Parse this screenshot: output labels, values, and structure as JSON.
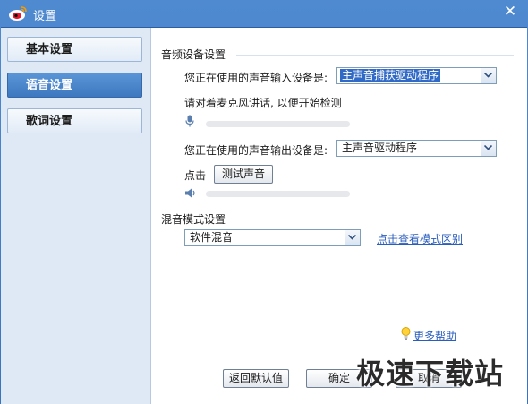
{
  "window": {
    "title": "设置",
    "close_glyph": "✕"
  },
  "sidebar": {
    "items": [
      {
        "label": "基本设置",
        "active": false
      },
      {
        "label": "语音设置",
        "active": true
      },
      {
        "label": "歌词设置",
        "active": false
      }
    ]
  },
  "audio_device": {
    "section_title": "音频设备设置",
    "input_label": "您正在使用的声音输入设备是:",
    "input_value": "主声音捕获驱动程序",
    "mic_hint": "请对着麦克风讲话, 以便开始检测",
    "mic_level": 0,
    "output_label": "您正在使用的声音输出设备是:",
    "output_value": "主声音驱动程序",
    "click_label": "点击",
    "test_button": "测试声音",
    "speaker_level": 0
  },
  "mix_mode": {
    "section_title": "混音模式设置",
    "mode_value": "软件混音",
    "diff_link": "点击查看模式区别"
  },
  "footer": {
    "help_link": "更多帮助",
    "reset_button": "返回默认值",
    "ok_button": "确定",
    "cancel_button": "取消"
  },
  "watermark": "极速下载站",
  "colors": {
    "titlebar": "#4f8ad1",
    "active_nav": "#4a86cc",
    "link": "#2a5dbd",
    "selection": "#3169c6"
  },
  "icons": [
    "weibo-logo-icon",
    "close-icon",
    "microphone-icon",
    "speaker-icon",
    "lightbulb-icon",
    "chevron-down-icon"
  ]
}
